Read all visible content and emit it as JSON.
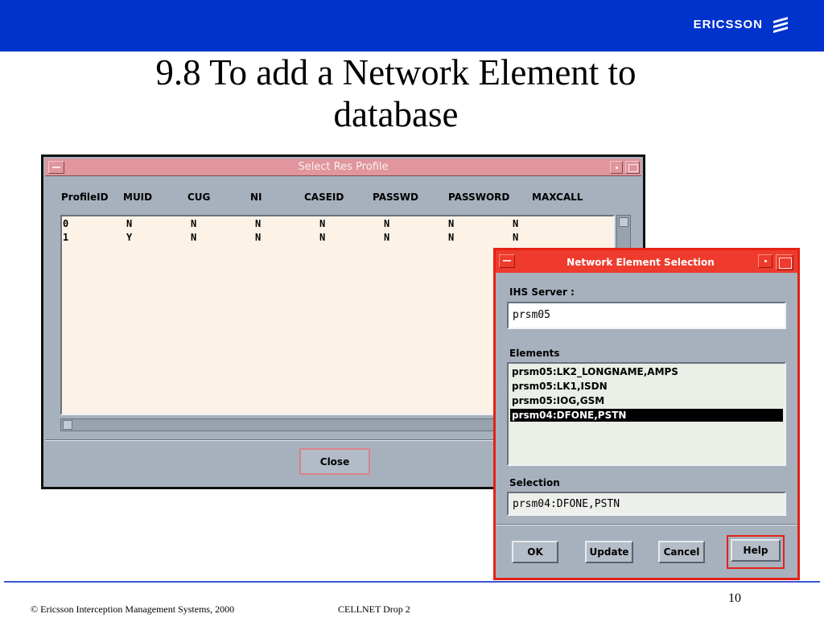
{
  "header": {
    "brand": "ERICSSON"
  },
  "slide": {
    "title_line1": "9.8 To add a Network Element to",
    "title_line2": "database"
  },
  "profile_window": {
    "title": "Select Res Profile",
    "columns": [
      "ProfileID",
      "MUID",
      "CUG",
      "NI",
      "CASEID",
      "PASSWD",
      "PASSWORD",
      "MAXCALL"
    ],
    "rows": [
      [
        "0",
        "N",
        "N",
        "N",
        "N",
        "N",
        "N",
        "N"
      ],
      [
        "1",
        "Y",
        "N",
        "N",
        "N",
        "N",
        "N",
        "N"
      ]
    ],
    "close_label": "Close"
  },
  "ne_window": {
    "title": "Network Element Selection",
    "server_label": "IHS Server :",
    "server_value": "prsm05",
    "elements_label": "Elements",
    "elements": [
      "prsm05:LK2_LONGNAME,AMPS",
      "prsm05:LK1,ISDN",
      "prsm05:IOG,GSM",
      "prsm04:DFONE,PSTN"
    ],
    "selected_index": 3,
    "selection_label": "Selection",
    "selection_value": "prsm04:DFONE,PSTN",
    "buttons": {
      "ok": "OK",
      "update": "Update",
      "cancel": "Cancel",
      "help": "Help"
    }
  },
  "footer": {
    "copyright": "© Ericsson Interception Management Systems, 2000",
    "project": "CELLNET Drop 2",
    "page_number": "10"
  },
  "colors": {
    "banner": "#0033cc",
    "profile_titlebar": "#e0969c",
    "ne_titlebar": "#ee3b2d",
    "window_bg": "#a7b1be",
    "list_bg": "#fcf3e6"
  }
}
